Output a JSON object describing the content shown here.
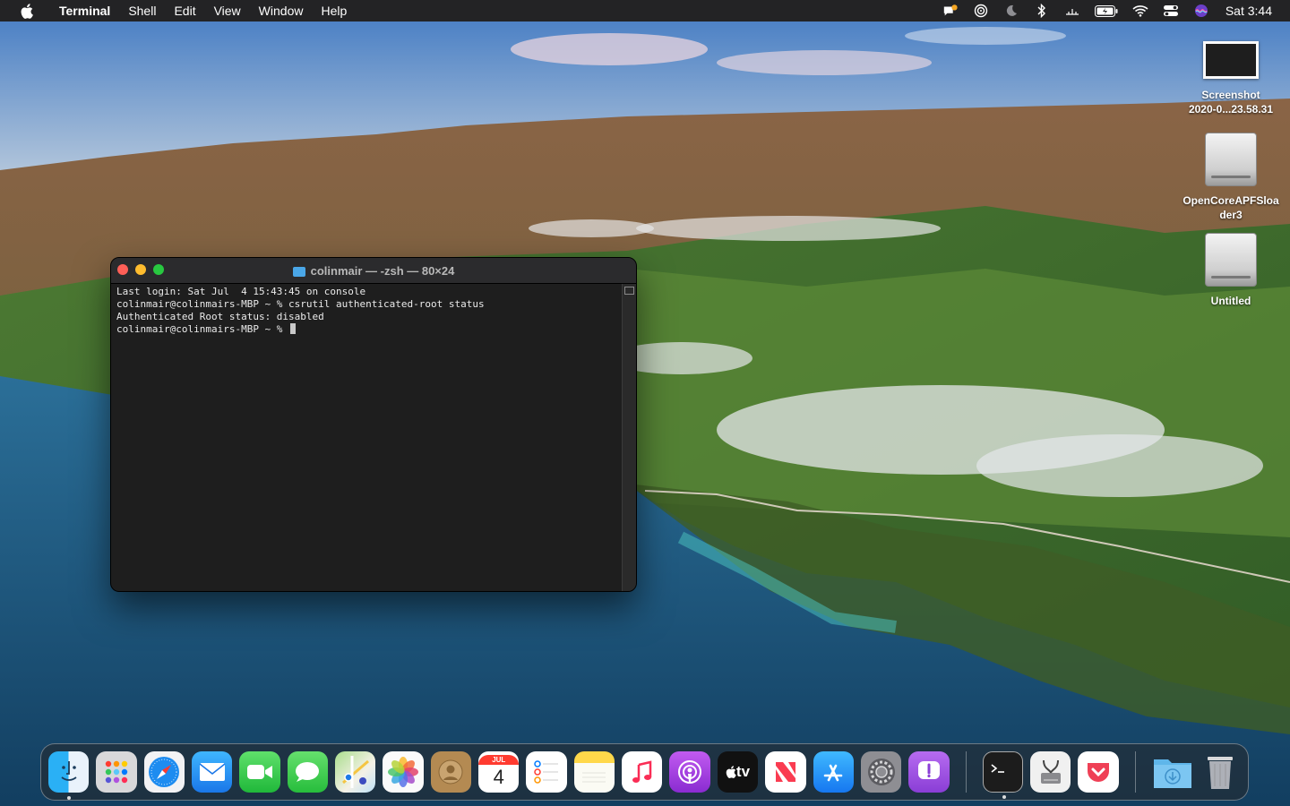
{
  "menubar": {
    "app_name": "Terminal",
    "menus": [
      "Shell",
      "Edit",
      "View",
      "Window",
      "Help"
    ],
    "clock": "Sat 3:44"
  },
  "desktop_icons": [
    {
      "label_line1": "Screenshot",
      "label_line2": "2020-0...23.58.31",
      "kind": "screenshot"
    },
    {
      "label_line1": "OpenCoreAPFSloa",
      "label_line2": "der3",
      "kind": "disk"
    },
    {
      "label_line1": "Untitled",
      "label_line2": "",
      "kind": "disk"
    }
  ],
  "terminal": {
    "title": "colinmair — -zsh — 80×24",
    "lines": [
      "Last login: Sat Jul  4 15:43:45 on console",
      "colinmair@colinmairs-MBP ~ % csrutil authenticated-root status",
      "Authenticated Root status: disabled",
      "colinmair@colinmairs-MBP ~ % "
    ]
  },
  "dock": {
    "calendar_month": "JUL",
    "calendar_day": "4",
    "tv_label": "tv",
    "apps": [
      "finder",
      "launchpad",
      "safari",
      "mail",
      "facetime",
      "messages",
      "maps",
      "photos",
      "contacts",
      "calendar",
      "reminders",
      "notes",
      "music",
      "podcasts",
      "tv",
      "news",
      "app-store",
      "system-preferences",
      "feedback-assistant",
      "terminal",
      "disk-utility",
      "pocket",
      "downloads",
      "trash"
    ]
  },
  "colors": {
    "menubar_bg": "#232325",
    "terminal_bg": "#1e1e1e",
    "close": "#ff5f57",
    "minimize": "#febc2e",
    "zoom": "#28c840"
  }
}
